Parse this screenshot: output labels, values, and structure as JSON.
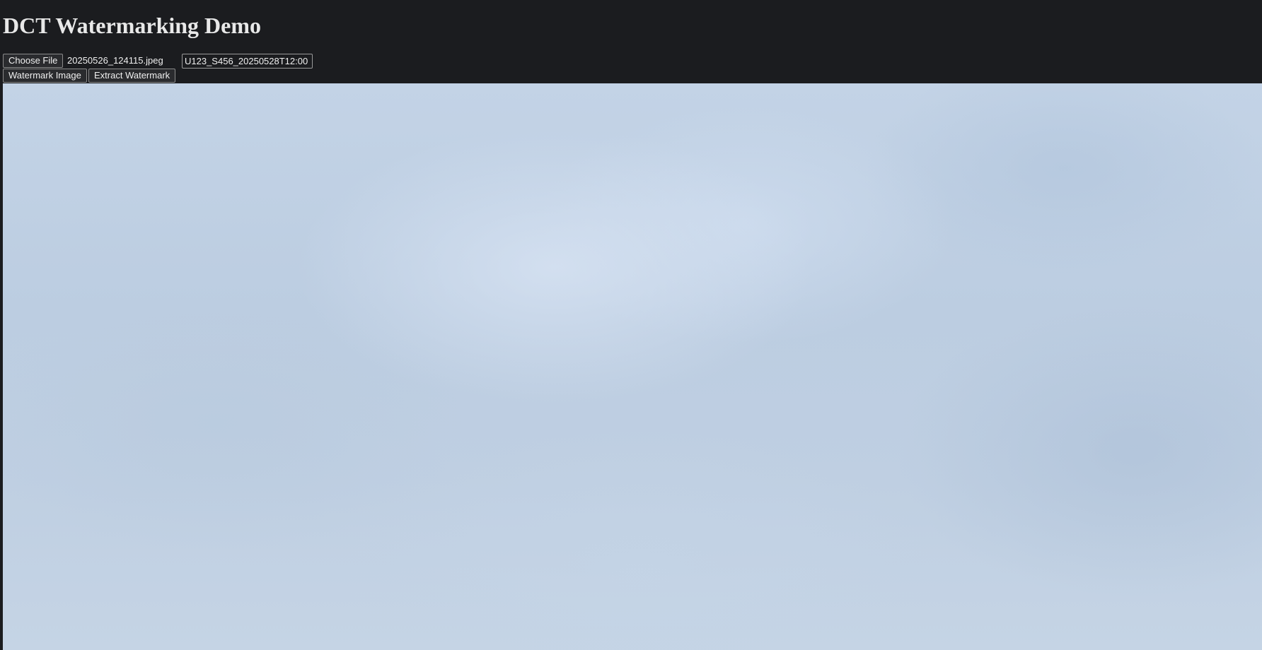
{
  "page": {
    "title": "DCT Watermarking Demo"
  },
  "file_picker": {
    "button_label": "Choose File",
    "selected_file": "20250526_124115.jpeg"
  },
  "watermark_input": {
    "value": "U123_S456_20250528T12:00"
  },
  "actions": {
    "watermark_label": "Watermark Image",
    "extract_label": "Extract Watermark"
  },
  "preview": {
    "description": "",
    "colors": {
      "sky_light": "#d4e2f2",
      "sky_mid": "#bccde1",
      "sky_dark": "#aabed6"
    }
  },
  "colors": {
    "background": "#1b1c1f",
    "text": "#e8e8e8"
  }
}
